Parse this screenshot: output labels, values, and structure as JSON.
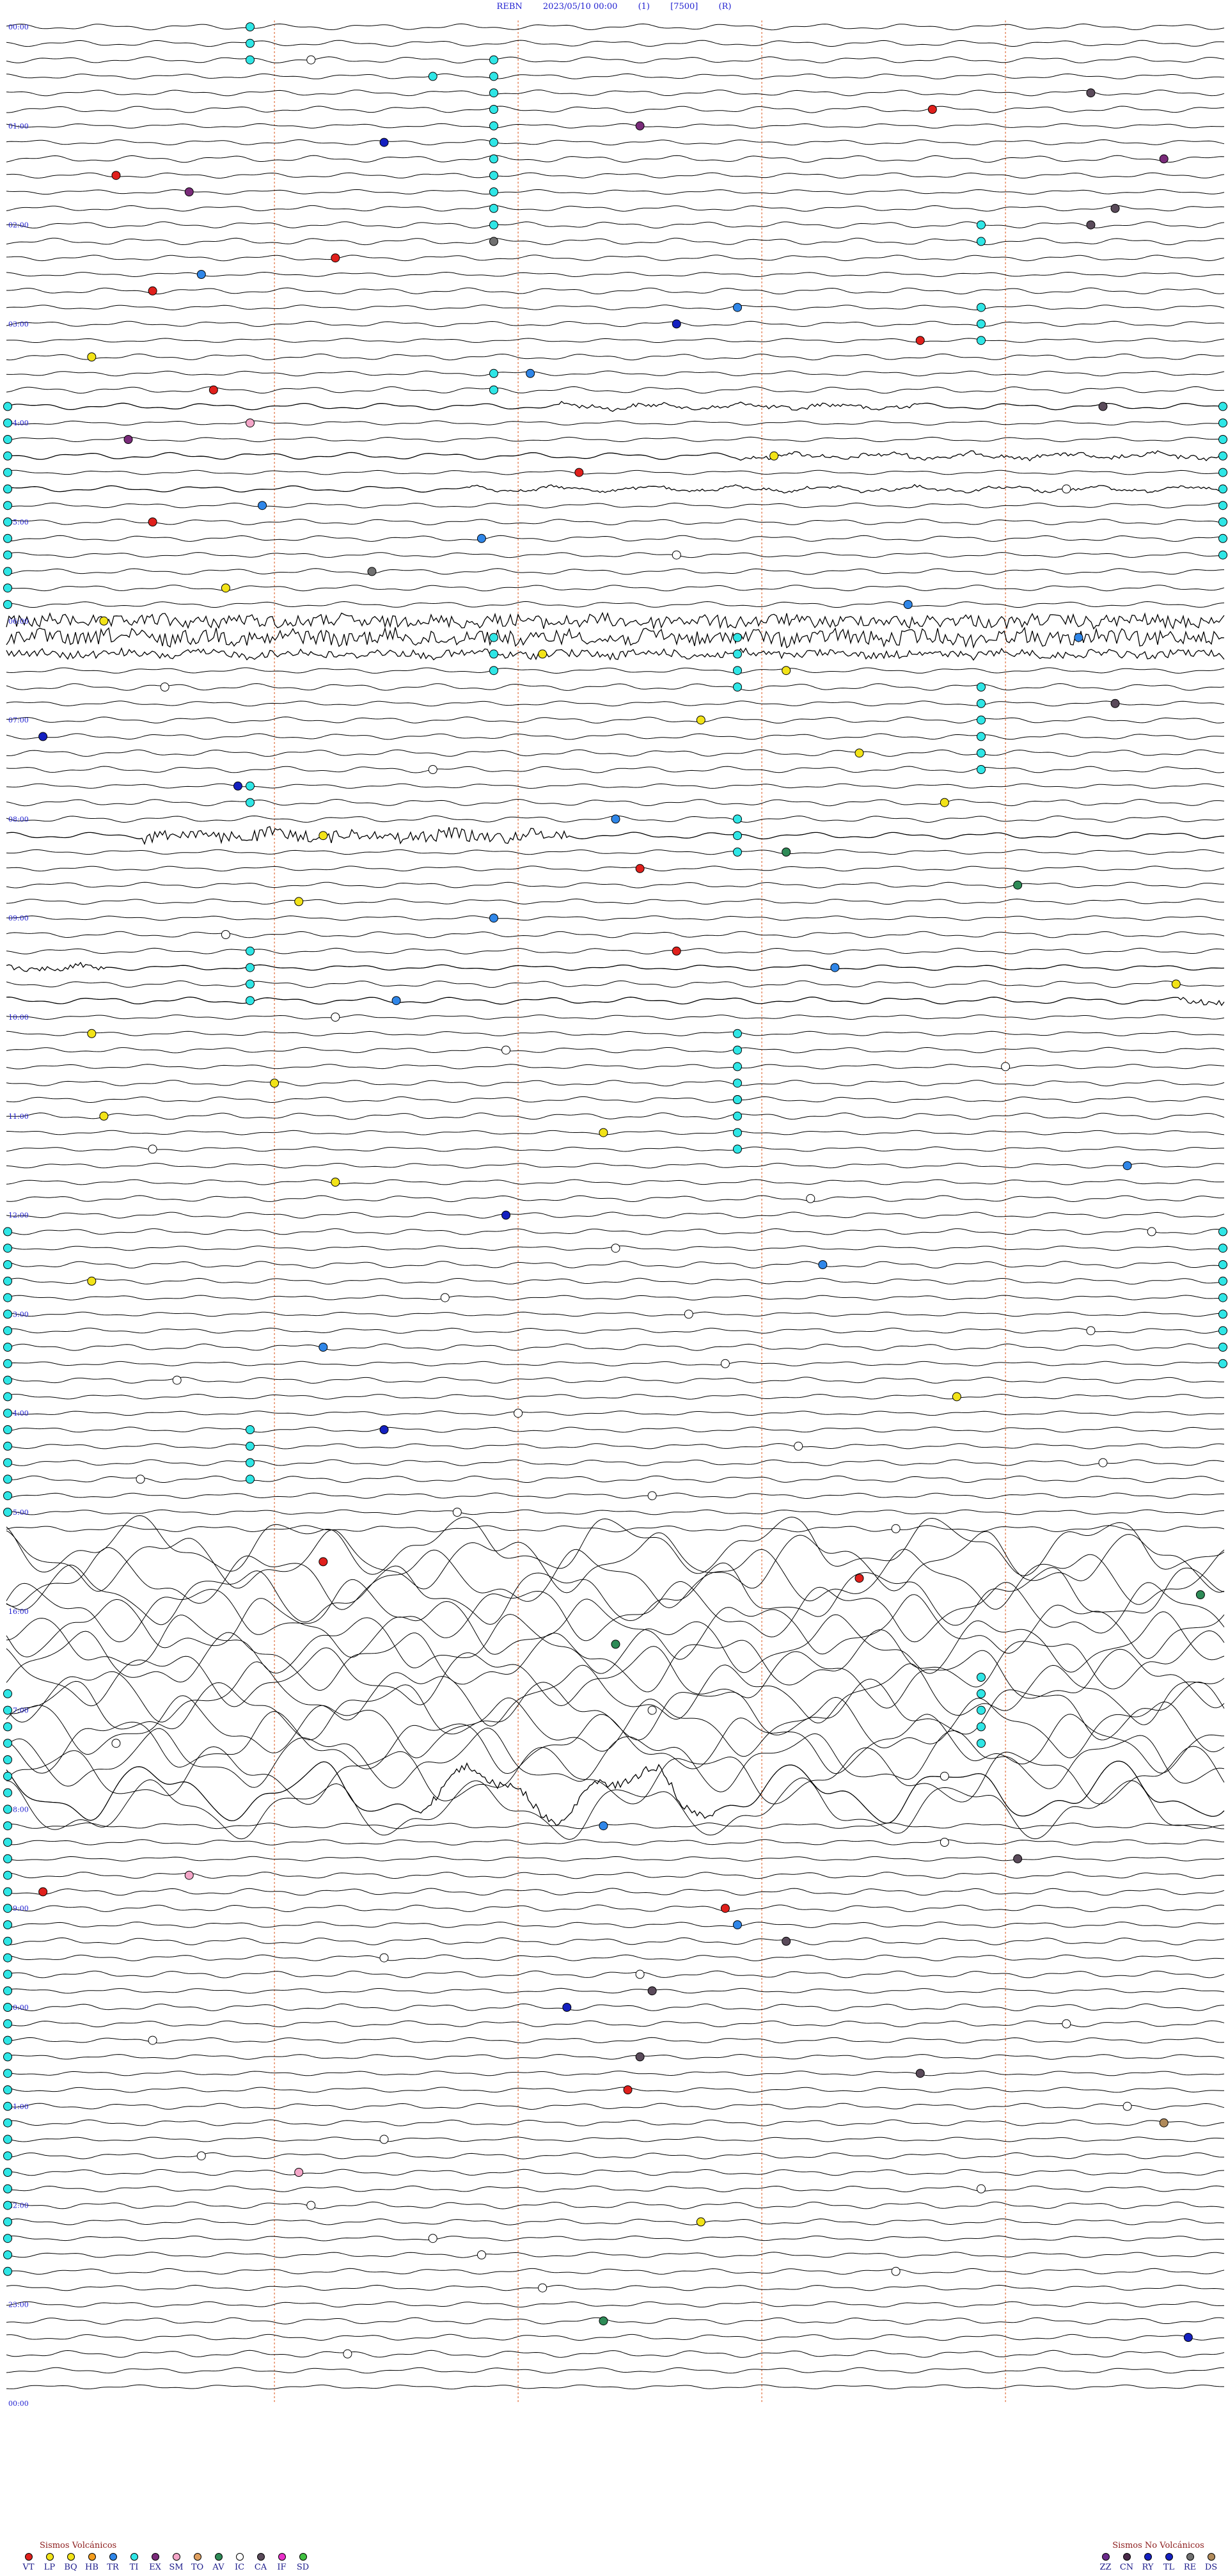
{
  "header": {
    "station": "REBN",
    "datetime": "2023/05/10 00:00",
    "channel": "(1)",
    "gain": "[7500]",
    "mode": "(R)"
  },
  "chart_data": {
    "type": "helicorder",
    "hour_labels": [
      "00:00",
      "01:00",
      "02:00",
      "03:00",
      "04:00",
      "05:00",
      "06:00",
      "07:00",
      "08:00",
      "09:00",
      "10:00",
      "11:00",
      "12:00",
      "13:00",
      "14:00",
      "15:00",
      "16:00",
      "17:00",
      "18:00",
      "19:00",
      "20:00",
      "21:00",
      "22:00",
      "23:00",
      "00:00"
    ],
    "trace_count": 144,
    "minutes_per_trace": 10,
    "minute_markers": [
      2.2,
      4.2,
      6.2,
      8.2
    ],
    "noisy_windows": [
      {
        "trace": 36,
        "start": 0.0,
        "end": 1.0,
        "amp": 10
      },
      {
        "trace": 37,
        "start": 0.0,
        "end": 1.0,
        "amp": 12
      },
      {
        "trace": 38,
        "start": 0.0,
        "end": 1.0,
        "amp": 6
      },
      {
        "trace": 49,
        "start": 0.11,
        "end": 0.46,
        "amp": 9
      },
      {
        "trace": 23,
        "start": 0.45,
        "end": 0.75,
        "amp": 3
      },
      {
        "trace": 107,
        "start": 0.34,
        "end": 0.58,
        "amp": 6
      },
      {
        "trace": 26,
        "start": 0.6,
        "end": 1.0,
        "amp": 3
      },
      {
        "trace": 28,
        "start": 0.38,
        "end": 1.0,
        "amp": 2
      },
      {
        "trace": 59,
        "start": 0.96,
        "end": 1.0,
        "amp": 5
      },
      {
        "trace": 57,
        "start": 0.0,
        "end": 0.08,
        "amp": 4
      }
    ],
    "storm_window": {
      "first_trace": 92,
      "last_trace": 108,
      "amp": 34
    },
    "events": [
      {
        "trace": 2,
        "x": 0.25,
        "type": "IC"
      },
      {
        "trace": 3,
        "x": 0.35,
        "type": "TI"
      },
      {
        "trace": 4,
        "x": 0.89,
        "type": "CA"
      },
      {
        "trace": 5,
        "x": 0.76,
        "type": "VT"
      },
      {
        "trace": 6,
        "x": 0.52,
        "type": "EX"
      },
      {
        "trace": 7,
        "x": 0.31,
        "type": "RY"
      },
      {
        "trace": 8,
        "x": 0.95,
        "type": "EX"
      },
      {
        "trace": 9,
        "x": 0.09,
        "type": "VT"
      },
      {
        "trace": 10,
        "x": 0.15,
        "type": "EX"
      },
      {
        "trace": 11,
        "x": 0.91,
        "type": "CA"
      },
      {
        "trace": 12,
        "x": 0.89,
        "type": "CA"
      },
      {
        "trace": 13,
        "x": 0.4,
        "type": "RE"
      },
      {
        "trace": 14,
        "x": 0.27,
        "type": "VT"
      },
      {
        "trace": 15,
        "x": 0.16,
        "type": "TR"
      },
      {
        "trace": 16,
        "x": 0.12,
        "type": "VT"
      },
      {
        "trace": 17,
        "x": 0.6,
        "type": "TR"
      },
      {
        "trace": 18,
        "x": 0.55,
        "type": "RY"
      },
      {
        "trace": 19,
        "x": 0.75,
        "type": "VT"
      },
      {
        "trace": 20,
        "x": 0.07,
        "type": "BQ"
      },
      {
        "trace": 21,
        "x": 0.43,
        "type": "TR"
      },
      {
        "trace": 22,
        "x": 0.17,
        "type": "VT"
      },
      {
        "trace": 23,
        "x": 0.9,
        "type": "CA"
      },
      {
        "trace": 24,
        "x": 0.2,
        "type": "SM"
      },
      {
        "trace": 25,
        "x": 0.1,
        "type": "EX"
      },
      {
        "trace": 26,
        "x": 0.63,
        "type": "BQ"
      },
      {
        "trace": 27,
        "x": 0.47,
        "type": "VT"
      },
      {
        "trace": 28,
        "x": 0.87,
        "type": "IC"
      },
      {
        "trace": 29,
        "x": 0.21,
        "type": "TR"
      },
      {
        "trace": 30,
        "x": 0.12,
        "type": "VT"
      },
      {
        "trace": 31,
        "x": 0.39,
        "type": "TR"
      },
      {
        "trace": 32,
        "x": 0.55,
        "type": "IC"
      },
      {
        "trace": 33,
        "x": 0.3,
        "type": "RE"
      },
      {
        "trace": 34,
        "x": 0.18,
        "type": "BQ"
      },
      {
        "trace": 35,
        "x": 0.74,
        "type": "TR"
      },
      {
        "trace": 36,
        "x": 0.08,
        "type": "BQ"
      },
      {
        "trace": 37,
        "x": 0.88,
        "type": "TR"
      },
      {
        "trace": 38,
        "x": 0.44,
        "type": "BQ"
      },
      {
        "trace": 39,
        "x": 0.64,
        "type": "BQ"
      },
      {
        "trace": 40,
        "x": 0.13,
        "type": "IC"
      },
      {
        "trace": 41,
        "x": 0.91,
        "type": "CA"
      },
      {
        "trace": 42,
        "x": 0.57,
        "type": "BQ"
      },
      {
        "trace": 43,
        "x": 0.03,
        "type": "RY"
      },
      {
        "trace": 44,
        "x": 0.7,
        "type": "BQ"
      },
      {
        "trace": 45,
        "x": 0.35,
        "type": "IC"
      },
      {
        "trace": 46,
        "x": 0.19,
        "type": "RY"
      },
      {
        "trace": 47,
        "x": 0.77,
        "type": "BQ"
      },
      {
        "trace": 48,
        "x": 0.5,
        "type": "TR"
      },
      {
        "trace": 49,
        "x": 0.26,
        "type": "BQ"
      },
      {
        "trace": 50,
        "x": 0.64,
        "type": "AV"
      },
      {
        "trace": 51,
        "x": 0.52,
        "type": "VT"
      },
      {
        "trace": 52,
        "x": 0.83,
        "type": "AV"
      },
      {
        "trace": 53,
        "x": 0.24,
        "type": "BQ"
      },
      {
        "trace": 54,
        "x": 0.4,
        "type": "TR"
      },
      {
        "trace": 55,
        "x": 0.18,
        "type": "IC"
      },
      {
        "trace": 56,
        "x": 0.55,
        "type": "VT"
      },
      {
        "trace": 57,
        "x": 0.68,
        "type": "TR"
      },
      {
        "trace": 58,
        "x": 0.96,
        "type": "BQ"
      },
      {
        "trace": 59,
        "x": 0.32,
        "type": "TR"
      },
      {
        "trace": 60,
        "x": 0.27,
        "type": "IC"
      },
      {
        "trace": 61,
        "x": 0.07,
        "type": "BQ"
      },
      {
        "trace": 62,
        "x": 0.41,
        "type": "IC"
      },
      {
        "trace": 63,
        "x": 0.82,
        "type": "IC"
      },
      {
        "trace": 64,
        "x": 0.22,
        "type": "BQ"
      },
      {
        "trace": 65,
        "x": 0.6,
        "type": "IC"
      },
      {
        "trace": 66,
        "x": 0.08,
        "type": "BQ"
      },
      {
        "trace": 67,
        "x": 0.49,
        "type": "BQ"
      },
      {
        "trace": 68,
        "x": 0.12,
        "type": "IC"
      },
      {
        "trace": 69,
        "x": 0.92,
        "type": "TR"
      },
      {
        "trace": 70,
        "x": 0.27,
        "type": "BQ"
      },
      {
        "trace": 71,
        "x": 0.66,
        "type": "IC"
      },
      {
        "trace": 72,
        "x": 0.41,
        "type": "RY"
      },
      {
        "trace": 73,
        "x": 0.94,
        "type": "IC"
      },
      {
        "trace": 74,
        "x": 0.5,
        "type": "IC"
      },
      {
        "trace": 75,
        "x": 0.67,
        "type": "TR"
      },
      {
        "trace": 76,
        "x": 0.07,
        "type": "BQ"
      },
      {
        "trace": 77,
        "x": 0.36,
        "type": "IC"
      },
      {
        "trace": 78,
        "x": 0.56,
        "type": "IC"
      },
      {
        "trace": 79,
        "x": 0.89,
        "type": "IC"
      },
      {
        "trace": 80,
        "x": 0.26,
        "type": "TR"
      },
      {
        "trace": 81,
        "x": 0.59,
        "type": "IC"
      },
      {
        "trace": 82,
        "x": 0.14,
        "type": "IC"
      },
      {
        "trace": 83,
        "x": 0.78,
        "type": "BQ"
      },
      {
        "trace": 84,
        "x": 0.42,
        "type": "IC"
      },
      {
        "trace": 85,
        "x": 0.31,
        "type": "RY"
      },
      {
        "trace": 86,
        "x": 0.65,
        "type": "IC"
      },
      {
        "trace": 87,
        "x": 0.9,
        "type": "IC"
      },
      {
        "trace": 88,
        "x": 0.11,
        "type": "IC"
      },
      {
        "trace": 89,
        "x": 0.53,
        "type": "IC"
      },
      {
        "trace": 90,
        "x": 0.37,
        "type": "IC"
      },
      {
        "trace": 91,
        "x": 0.73,
        "type": "IC"
      },
      {
        "trace": 93,
        "x": 0.26,
        "type": "VT"
      },
      {
        "trace": 94,
        "x": 0.7,
        "type": "VT"
      },
      {
        "trace": 95,
        "x": 0.98,
        "type": "AV"
      },
      {
        "trace": 98,
        "x": 0.5,
        "type": "AV"
      },
      {
        "trace": 102,
        "x": 0.53,
        "type": "IC"
      },
      {
        "trace": 104,
        "x": 0.09,
        "type": "IC"
      },
      {
        "trace": 106,
        "x": 0.77,
        "type": "IC"
      },
      {
        "trace": 109,
        "x": 0.49,
        "type": "TR"
      },
      {
        "trace": 110,
        "x": 0.77,
        "type": "IC"
      },
      {
        "trace": 111,
        "x": 0.83,
        "type": "CA"
      },
      {
        "trace": 112,
        "x": 0.15,
        "type": "SM"
      },
      {
        "trace": 113,
        "x": 0.03,
        "type": "VT"
      },
      {
        "trace": 114,
        "x": 0.59,
        "type": "VT"
      },
      {
        "trace": 115,
        "x": 0.6,
        "type": "TR"
      },
      {
        "trace": 116,
        "x": 0.64,
        "type": "CA"
      },
      {
        "trace": 117,
        "x": 0.31,
        "type": "IC"
      },
      {
        "trace": 118,
        "x": 0.52,
        "type": "IC"
      },
      {
        "trace": 119,
        "x": 0.53,
        "type": "CA"
      },
      {
        "trace": 120,
        "x": 0.46,
        "type": "RY"
      },
      {
        "trace": 121,
        "x": 0.87,
        "type": "IC"
      },
      {
        "trace": 122,
        "x": 0.12,
        "type": "IC"
      },
      {
        "trace": 123,
        "x": 0.52,
        "type": "CA"
      },
      {
        "trace": 124,
        "x": 0.75,
        "type": "CA"
      },
      {
        "trace": 125,
        "x": 0.51,
        "type": "VT"
      },
      {
        "trace": 126,
        "x": 0.92,
        "type": "IC"
      },
      {
        "trace": 127,
        "x": 0.95,
        "type": "DS"
      },
      {
        "trace": 128,
        "x": 0.31,
        "type": "IC"
      },
      {
        "trace": 129,
        "x": 0.16,
        "type": "IC"
      },
      {
        "trace": 130,
        "x": 0.24,
        "type": "SM"
      },
      {
        "trace": 131,
        "x": 0.8,
        "type": "IC"
      },
      {
        "trace": 132,
        "x": 0.25,
        "type": "IC"
      },
      {
        "trace": 133,
        "x": 0.57,
        "type": "BQ"
      },
      {
        "trace": 134,
        "x": 0.35,
        "type": "IC"
      },
      {
        "trace": 135,
        "x": 0.39,
        "type": "IC"
      },
      {
        "trace": 136,
        "x": 0.73,
        "type": "IC"
      },
      {
        "trace": 137,
        "x": 0.44,
        "type": "IC"
      },
      {
        "trace": 139,
        "x": 0.49,
        "type": "AV"
      },
      {
        "trace": 140,
        "x": 0.97,
        "type": "TL"
      },
      {
        "trace": 141,
        "x": 0.28,
        "type": "IC"
      }
    ],
    "columns": [
      {
        "x": 0.2,
        "first_trace": 0,
        "last_trace": 2,
        "type": "TI"
      },
      {
        "x": 0.4,
        "first_trace": 2,
        "last_trace": 12,
        "type": "TI"
      },
      {
        "x": 0.8,
        "first_trace": 12,
        "last_trace": 13,
        "type": "TI"
      },
      {
        "x": 0.8,
        "first_trace": 17,
        "last_trace": 19,
        "type": "TI"
      },
      {
        "x": 0.4,
        "first_trace": 21,
        "last_trace": 22,
        "type": "TI"
      },
      {
        "x": 1.0,
        "first_trace": 23,
        "last_trace": 32,
        "type": "TI"
      },
      {
        "x": 0.0,
        "first_trace": 23,
        "last_trace": 35,
        "type": "TI"
      },
      {
        "x": 0.4,
        "first_trace": 37,
        "last_trace": 39,
        "type": "TI"
      },
      {
        "x": 0.6,
        "first_trace": 37,
        "last_trace": 40,
        "type": "TI"
      },
      {
        "x": 0.8,
        "first_trace": 40,
        "last_trace": 45,
        "type": "TI"
      },
      {
        "x": 0.2,
        "first_trace": 46,
        "last_trace": 47,
        "type": "TI"
      },
      {
        "x": 0.6,
        "first_trace": 48,
        "last_trace": 50,
        "type": "TI"
      },
      {
        "x": 0.2,
        "first_trace": 56,
        "last_trace": 59,
        "type": "TI"
      },
      {
        "x": 0.6,
        "first_trace": 61,
        "last_trace": 68,
        "type": "TI"
      },
      {
        "x": 1.0,
        "first_trace": 73,
        "last_trace": 81,
        "type": "TI"
      },
      {
        "x": 0.0,
        "first_trace": 73,
        "last_trace": 90,
        "type": "TI"
      },
      {
        "x": 0.2,
        "first_trace": 85,
        "last_trace": 88,
        "type": "TI"
      },
      {
        "x": 0.8,
        "first_trace": 100,
        "last_trace": 104,
        "type": "TI"
      },
      {
        "x": 0.0,
        "first_trace": 101,
        "last_trace": 136,
        "type": "TI"
      }
    ]
  },
  "legend_volcanic": {
    "title": "Sismos Volcánicos",
    "items": [
      {
        "code": "VT",
        "color": "#e0201c"
      },
      {
        "code": "LP",
        "color": "#f2e318"
      },
      {
        "code": "BQ",
        "color": "#f2e318"
      },
      {
        "code": "HB",
        "color": "#f39c1c"
      },
      {
        "code": "TR",
        "color": "#2f86e8"
      },
      {
        "code": "TI",
        "color": "#2fe6e6"
      },
      {
        "code": "EX",
        "color": "#7a2b7a"
      },
      {
        "code": "SM",
        "color": "#f4a6c8"
      },
      {
        "code": "TO",
        "color": "#e0a060"
      },
      {
        "code": "AV",
        "color": "#2e8b57"
      },
      {
        "code": "IC",
        "color": "#ffffff"
      },
      {
        "code": "CA",
        "color": "#5a4a5a"
      },
      {
        "code": "IF",
        "color": "#e830c8"
      },
      {
        "code": "SD",
        "color": "#40c040"
      }
    ]
  },
  "legend_nonvolcanic": {
    "title": "Sismos No Volcánicos",
    "items": [
      {
        "code": "ZZ",
        "color": "#6a2a8a"
      },
      {
        "code": "CN",
        "color": "#4a2a4a"
      },
      {
        "code": "RY",
        "color": "#1420c0"
      },
      {
        "code": "TL",
        "color": "#1420c0"
      },
      {
        "code": "RE",
        "color": "#707070"
      },
      {
        "code": "DS",
        "color": "#b08a5a"
      }
    ]
  }
}
